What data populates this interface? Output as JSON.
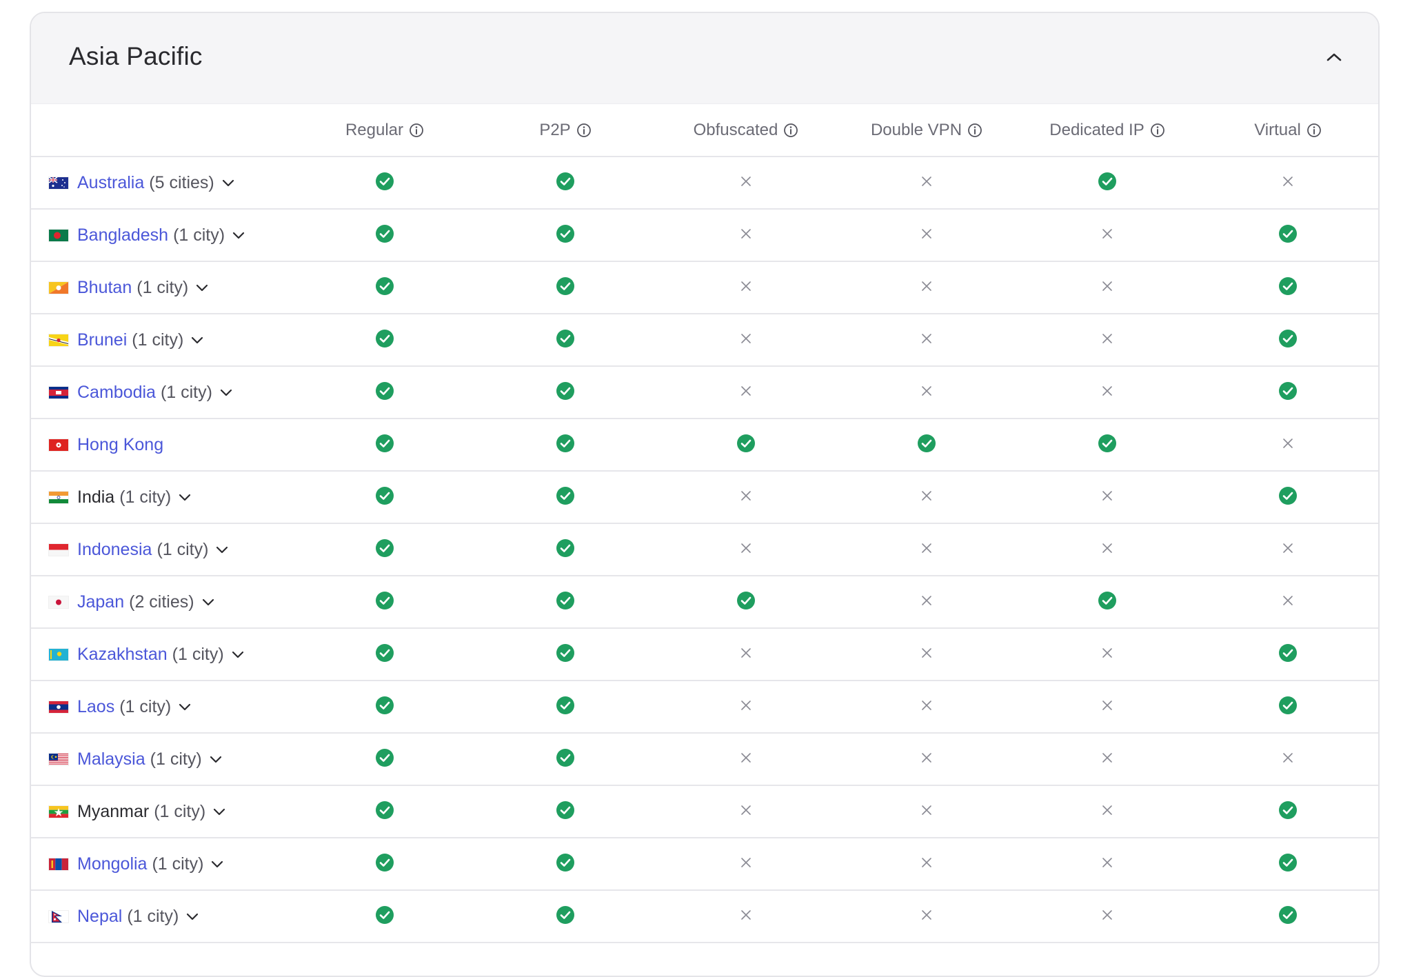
{
  "section": {
    "title": "Asia Pacific"
  },
  "columns": [
    {
      "label": "Regular"
    },
    {
      "label": "P2P"
    },
    {
      "label": "Obfuscated"
    },
    {
      "label": "Double VPN"
    },
    {
      "label": "Dedicated IP"
    },
    {
      "label": "Virtual"
    }
  ],
  "colors": {
    "check": "#1f9e5f",
    "cross": "#8a8a93",
    "link": "#4b57d9"
  },
  "countries": [
    {
      "name": "Australia",
      "cities": "(5 cities)",
      "link": true,
      "expandable": true,
      "flag": "australia-flag-icon",
      "features": [
        true,
        true,
        false,
        false,
        true,
        false
      ]
    },
    {
      "name": "Bangladesh",
      "cities": "(1 city)",
      "link": true,
      "expandable": true,
      "flag": "bangladesh-flag-icon",
      "features": [
        true,
        true,
        false,
        false,
        false,
        true
      ]
    },
    {
      "name": "Bhutan",
      "cities": "(1 city)",
      "link": true,
      "expandable": true,
      "flag": "bhutan-flag-icon",
      "features": [
        true,
        true,
        false,
        false,
        false,
        true
      ]
    },
    {
      "name": "Brunei",
      "cities": "(1 city)",
      "link": true,
      "expandable": true,
      "flag": "brunei-flag-icon",
      "features": [
        true,
        true,
        false,
        false,
        false,
        true
      ]
    },
    {
      "name": "Cambodia",
      "cities": "(1 city)",
      "link": true,
      "expandable": true,
      "flag": "cambodia-flag-icon",
      "features": [
        true,
        true,
        false,
        false,
        false,
        true
      ]
    },
    {
      "name": "Hong Kong",
      "cities": "",
      "link": true,
      "expandable": false,
      "flag": "hong-kong-flag-icon",
      "features": [
        true,
        true,
        true,
        true,
        true,
        false
      ]
    },
    {
      "name": "India",
      "cities": "(1 city)",
      "link": false,
      "expandable": true,
      "flag": "india-flag-icon",
      "features": [
        true,
        true,
        false,
        false,
        false,
        true
      ]
    },
    {
      "name": "Indonesia",
      "cities": "(1 city)",
      "link": true,
      "expandable": true,
      "flag": "indonesia-flag-icon",
      "features": [
        true,
        true,
        false,
        false,
        false,
        false
      ]
    },
    {
      "name": "Japan",
      "cities": "(2 cities)",
      "link": true,
      "expandable": true,
      "flag": "japan-flag-icon",
      "features": [
        true,
        true,
        true,
        false,
        true,
        false
      ]
    },
    {
      "name": "Kazakhstan",
      "cities": "(1 city)",
      "link": true,
      "expandable": true,
      "flag": "kazakhstan-flag-icon",
      "features": [
        true,
        true,
        false,
        false,
        false,
        true
      ]
    },
    {
      "name": "Laos",
      "cities": "(1 city)",
      "link": true,
      "expandable": true,
      "flag": "laos-flag-icon",
      "features": [
        true,
        true,
        false,
        false,
        false,
        true
      ]
    },
    {
      "name": "Malaysia",
      "cities": "(1 city)",
      "link": true,
      "expandable": true,
      "flag": "malaysia-flag-icon",
      "features": [
        true,
        true,
        false,
        false,
        false,
        false
      ]
    },
    {
      "name": "Myanmar",
      "cities": "(1 city)",
      "link": false,
      "expandable": true,
      "flag": "myanmar-flag-icon",
      "features": [
        true,
        true,
        false,
        false,
        false,
        true
      ]
    },
    {
      "name": "Mongolia",
      "cities": "(1 city)",
      "link": true,
      "expandable": true,
      "flag": "mongolia-flag-icon",
      "features": [
        true,
        true,
        false,
        false,
        false,
        true
      ]
    },
    {
      "name": "Nepal",
      "cities": "(1 city)",
      "link": true,
      "expandable": true,
      "flag": "nepal-flag-icon",
      "features": [
        true,
        true,
        false,
        false,
        false,
        true
      ]
    }
  ]
}
